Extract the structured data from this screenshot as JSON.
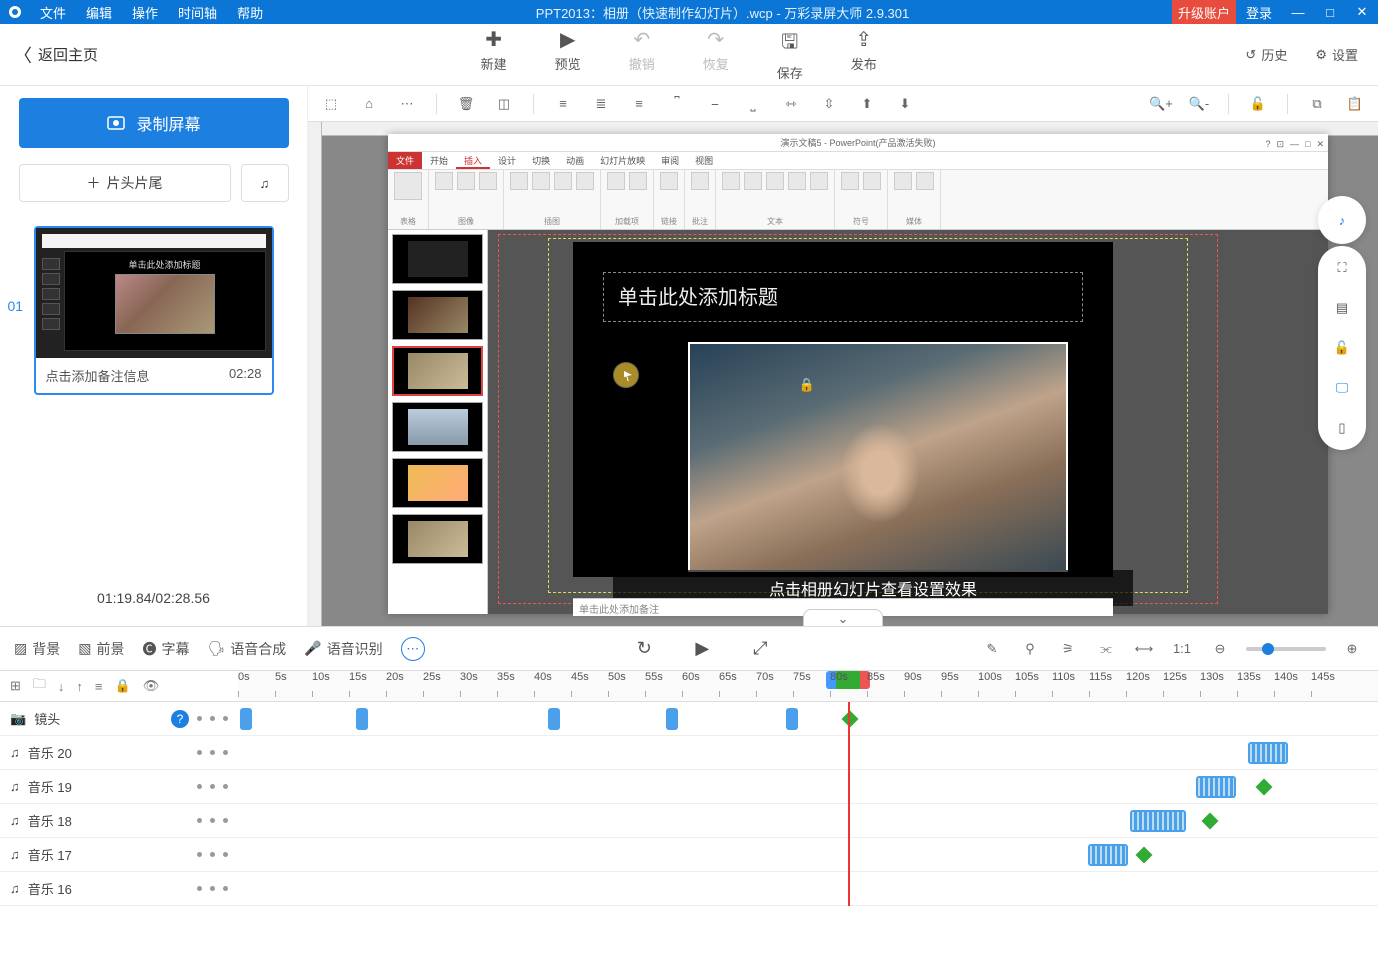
{
  "titlebar": {
    "menus": [
      "文件",
      "编辑",
      "操作",
      "时间轴",
      "帮助"
    ],
    "title": "PPT2013：相册（快速制作幻灯片）.wcp - 万彩录屏大师 2.9.301",
    "upgrade": "升级账户",
    "login": "登录"
  },
  "toolbar": {
    "back": "返回主页",
    "new": "新建",
    "preview": "预览",
    "undo": "撤销",
    "redo": "恢复",
    "save": "保存",
    "publish": "发布",
    "history": "历史",
    "settings": "设置"
  },
  "left": {
    "record": "录制屏幕",
    "head_tail": "片头片尾",
    "scene_num": "01",
    "note_placeholder": "点击添加备注信息",
    "scene_dur": "02:28",
    "time_status": "01:19.84/02:28.56"
  },
  "ppt": {
    "win_title": "演示文稿5 - PowerPoint(产品激活失败)",
    "tabs": [
      "文件",
      "开始",
      "插入",
      "设计",
      "切换",
      "动画",
      "幻灯片放映",
      "审阅",
      "视图"
    ],
    "ribbon_groups": [
      "表格",
      "图像",
      "插图",
      "加载项",
      "链接",
      "批注",
      "文本",
      "符号",
      "媒体"
    ],
    "slide_title_ph": "单击此处添加标题",
    "notes_ph": "单击此处添加备注",
    "caption": "点击相册幻灯片查看设置效果"
  },
  "tl_tabs": {
    "bg": "背景",
    "fg": "前景",
    "sub": "字幕",
    "tts": "语音合成",
    "asr": "语音识别"
  },
  "ruler": [
    "0s",
    "5s",
    "10s",
    "15s",
    "20s",
    "25s",
    "30s",
    "35s",
    "40s",
    "45s",
    "50s",
    "55s",
    "60s",
    "65s",
    "70s",
    "75s",
    "80s",
    "85s",
    "90s",
    "95s",
    "100s",
    "105s",
    "110s",
    "115s",
    "120s",
    "125s",
    "130s",
    "135s",
    "140s",
    "145s"
  ],
  "tracks": {
    "cam": "镜头",
    "m20": "音乐 20",
    "m19": "音乐 19",
    "m18": "音乐 18",
    "m17": "音乐 17",
    "m16": "音乐 16"
  }
}
